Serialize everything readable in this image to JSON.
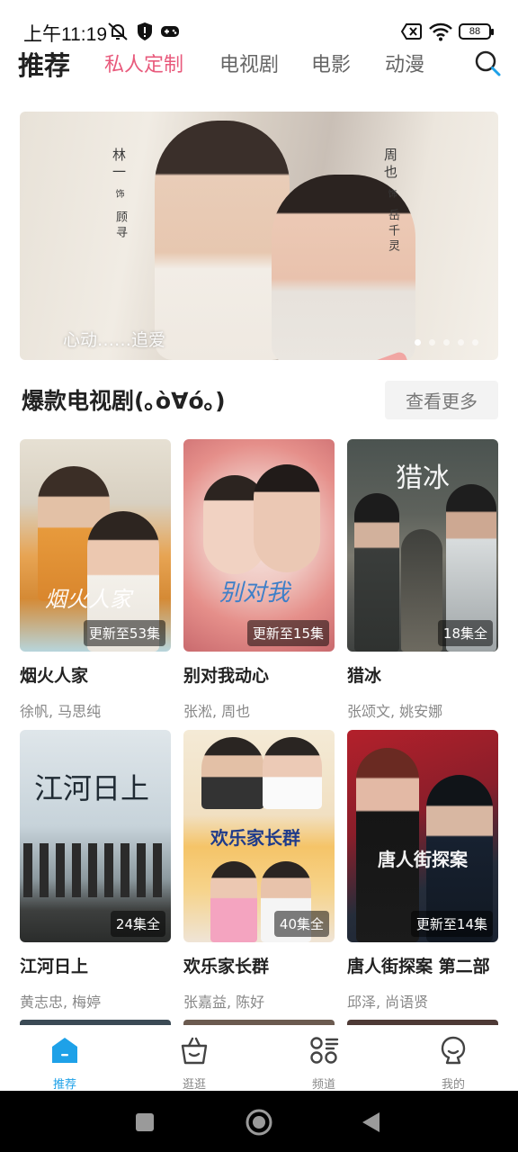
{
  "status_bar": {
    "time": "上午11:19",
    "battery": "88"
  },
  "top_nav": {
    "main": "推荐",
    "tabs": [
      "私人定制",
      "电视剧",
      "电影",
      "动漫"
    ],
    "active_tab": "私人定制",
    "accent_color": "#e85a7c"
  },
  "banner": {
    "caption": "心动……追爱",
    "vertical_left": [
      "林一",
      "饰",
      "顾寻"
    ],
    "vertical_right": [
      "周也",
      "饰",
      "岳千灵"
    ],
    "dot_count": 5,
    "active_dot": 0
  },
  "section": {
    "title": "爆款电视剧(｡ò∀ó｡)",
    "more_label": "查看更多"
  },
  "dramas": [
    {
      "title": "烟火人家",
      "cast": "徐帆, 马思纯",
      "badge": "更新至53集",
      "poster_text": "烟火人家"
    },
    {
      "title": "别对我动心",
      "cast": "张淞, 周也",
      "badge": "更新至15集",
      "poster_text": "别对我"
    },
    {
      "title": "猎冰",
      "cast": "张颂文, 姚安娜",
      "badge": "18集全",
      "poster_text": "猎冰"
    },
    {
      "title": "江河日上",
      "cast": "黄志忠, 梅婷",
      "badge": "24集全",
      "poster_text": "江河日上"
    },
    {
      "title": "欢乐家长群",
      "cast": "张嘉益, 陈好",
      "badge": "40集全",
      "poster_text": "欢乐家长群"
    },
    {
      "title": "唐人街探案 第二部",
      "cast": "邱泽, 尚语贤",
      "badge": "更新至14集",
      "poster_text": "唐人街探案"
    }
  ],
  "bottom_nav": {
    "items": [
      {
        "label": "推荐",
        "icon": "home-icon"
      },
      {
        "label": "逛逛",
        "icon": "basket-icon"
      },
      {
        "label": "频道",
        "icon": "channels-icon"
      },
      {
        "label": "我的",
        "icon": "profile-icon"
      }
    ],
    "active": "推荐",
    "active_color": "#1ea1e8"
  }
}
